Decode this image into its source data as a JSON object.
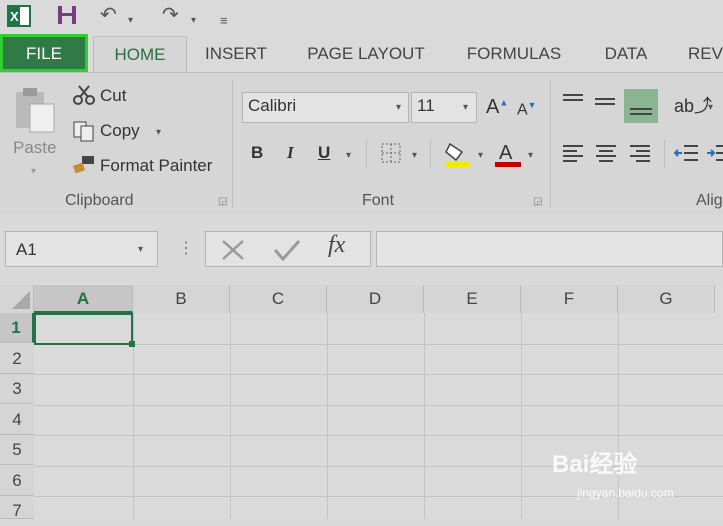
{
  "quick_access": {
    "icons": [
      "excel-logo-icon",
      "save-icon",
      "undo-icon",
      "redo-icon",
      "customize-toolbar-icon"
    ]
  },
  "tabs": [
    {
      "label": "FILE"
    },
    {
      "label": "HOME"
    },
    {
      "label": "INSERT"
    },
    {
      "label": "PAGE LAYOUT"
    },
    {
      "label": "FORMULAS"
    },
    {
      "label": "DATA"
    },
    {
      "label": "REV"
    }
  ],
  "ribbon": {
    "clipboard": {
      "paste": "Paste",
      "cut": "Cut",
      "copy": "Copy",
      "format_painter": "Format Painter",
      "group_label": "Clipboard"
    },
    "font": {
      "font_name": "Calibri",
      "font_size": "11",
      "bold": "B",
      "italic": "I",
      "underline": "U",
      "group_label": "Font",
      "fill_color": "#f5e800",
      "font_color": "#c00000"
    },
    "alignment": {
      "group_label": "Alig"
    }
  },
  "formula_bar": {
    "name_box": "A1",
    "fx": "fx",
    "formula": ""
  },
  "grid": {
    "columns": [
      "A",
      "B",
      "C",
      "D",
      "E",
      "F",
      "G"
    ],
    "rows": [
      "1",
      "2",
      "3",
      "4",
      "5",
      "6",
      "7"
    ],
    "selected_cell": "A1",
    "accent": "#217346"
  },
  "watermark": {
    "brand": "Bai经验",
    "url": "jingyan.baidu.com"
  }
}
